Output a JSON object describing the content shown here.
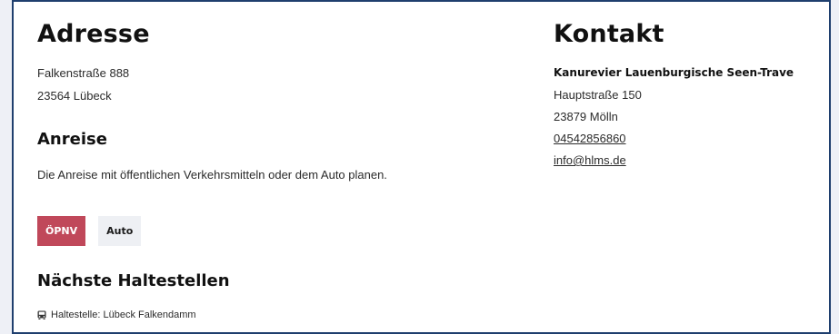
{
  "address": {
    "title": "Adresse",
    "street": "Falkenstraße 888",
    "city": "23564 Lübeck"
  },
  "anreise": {
    "title": "Anreise",
    "description": "Die Anreise mit öffentlichen Verkehrsmitteln oder dem Auto planen.",
    "buttons": {
      "oepnv": "ÖPNV",
      "auto": "Auto"
    },
    "active_color": "#c0485a"
  },
  "stops": {
    "title": "Nächste Haltestellen",
    "items": [
      {
        "icon": "bus-icon",
        "label": "Haltestelle: Lübeck Falkendamm"
      }
    ]
  },
  "contact": {
    "title": "Kontakt",
    "org": "Kanurevier Lauenburgische Seen-Trave",
    "street": "Hauptstraße 150",
    "city": "23879 Mölln",
    "phone": "04542856860",
    "email": "info@hlms.de"
  },
  "colors": {
    "border": "#1f3f6e",
    "page_bg": "#eef0f6"
  }
}
